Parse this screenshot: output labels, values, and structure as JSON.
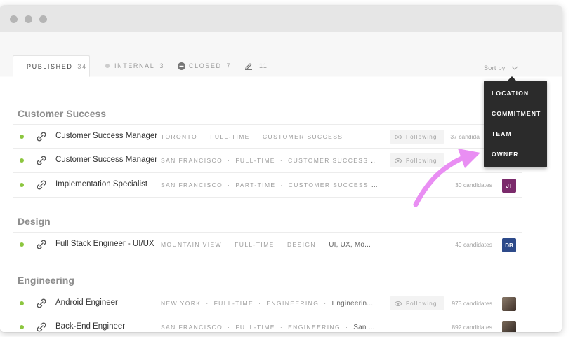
{
  "tabs": [
    {
      "label": "Published",
      "count": "34",
      "bullet_color": "#8cc63f"
    },
    {
      "label": "Internal",
      "count": "3",
      "bullet_color": "#cccccc"
    },
    {
      "label": "Closed",
      "count": "7"
    },
    {
      "label": "",
      "count": "11"
    }
  ],
  "sort": {
    "label": "Sort by"
  },
  "dropdown": {
    "items": [
      "Location",
      "Commitment",
      "Team",
      "Owner"
    ]
  },
  "sections": [
    {
      "name": "Customer Success",
      "rows": [
        {
          "title": "Customer Success Manager",
          "location": "Toronto",
          "commitment": "Full-time",
          "team": "Customer Success",
          "tags": "",
          "following": "Following",
          "candidates": "37 candida"
        },
        {
          "title": "Customer Success Manager",
          "location": "San Francisco",
          "commitment": "Full-time",
          "team": "Customer Success",
          "tags": "...",
          "following": "Following",
          "candidates": ""
        },
        {
          "title": "Implementation Specialist",
          "location": "San Francisco",
          "commitment": "Part-time",
          "team": "Customer Success",
          "tags": "...",
          "following": "",
          "candidates": "30 candidates",
          "avatar": "JT",
          "avatar_color": "#7b2a6b"
        }
      ]
    },
    {
      "name": "Design",
      "rows": [
        {
          "title": "Full Stack Engineer - UI/UX",
          "location": "Mountain View",
          "commitment": "Full-time",
          "team": "Design",
          "tags": "UI, UX, Mo...",
          "following": "",
          "candidates": "49 candidates",
          "avatar": "DB",
          "avatar_color": "#2d4a8a"
        }
      ]
    },
    {
      "name": "Engineering",
      "rows": [
        {
          "title": "Android Engineer",
          "location": "New York",
          "commitment": "Full-time",
          "team": "Engineering",
          "tags": "Engineerin...",
          "following": "Following",
          "candidates": "973 candidates",
          "avatar": "",
          "avatar_color": "#6b5a4a"
        },
        {
          "title": "Back-End Engineer",
          "location": "San Francisco",
          "commitment": "Full-time",
          "team": "Engineering",
          "tags": "San ...",
          "following": "",
          "candidates": "892 candidates",
          "avatar": "",
          "avatar_color": "#5a4a3e"
        }
      ]
    }
  ],
  "colors": {
    "status_green": "#8cc63f",
    "arrow": "#e98ef3",
    "dropdown_bg": "#2b2b2b"
  }
}
